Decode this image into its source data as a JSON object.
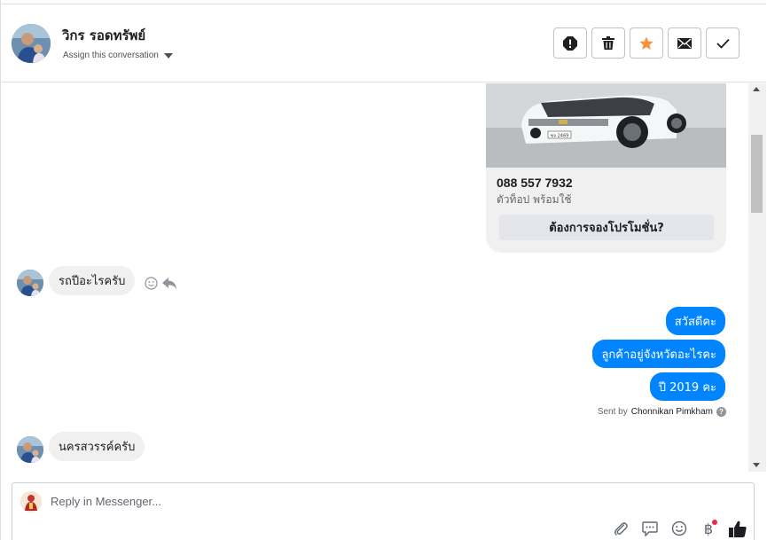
{
  "header": {
    "contact_name": "วิกร รอดทรัพย์",
    "assign_label": "Assign this conversation",
    "actions": [
      "spam-icon",
      "trash-icon",
      "star-icon",
      "envelope-icon",
      "checkmark-icon"
    ]
  },
  "card": {
    "phone": "088 557 7932",
    "subtitle": "ตัวท็อป พร้อมใช้",
    "button_label": "ต้องการจองโปรโมชั่น?",
    "plate": "ชจ 2469"
  },
  "messages": [
    {
      "direction": "in",
      "text": "รถปีอะไรครับ"
    },
    {
      "direction": "out",
      "text": "สวัสดีคะ"
    },
    {
      "direction": "out",
      "text": "ลูกค้าอยู่จังหวัดอะไรคะ"
    },
    {
      "direction": "out",
      "text": "ปี 2019 คะ"
    },
    {
      "direction": "in",
      "text": "นครสวรรค์ครับ"
    }
  ],
  "sent_by": {
    "prefix": "Sent by",
    "name": "Chonnikan Pimkham"
  },
  "composer": {
    "placeholder": "Reply in Messenger..."
  },
  "colors": {
    "accent": "#0084ff",
    "incoming_bubble": "#f1f0f0",
    "star": "#f7923b"
  }
}
